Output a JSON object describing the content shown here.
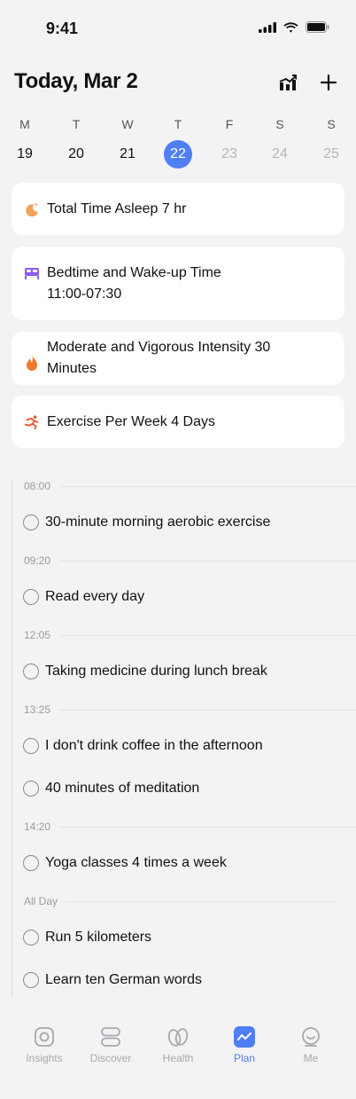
{
  "status_bar": {
    "time": "9:41"
  },
  "header": {
    "title": "Today, Mar 2"
  },
  "week": [
    {
      "dow": "M",
      "num": "19",
      "state": "past"
    },
    {
      "dow": "T",
      "num": "20",
      "state": "past"
    },
    {
      "dow": "W",
      "num": "21",
      "state": "past"
    },
    {
      "dow": "T",
      "num": "22",
      "state": "selected"
    },
    {
      "dow": "F",
      "num": "23",
      "state": "future"
    },
    {
      "dow": "S",
      "num": "24",
      "state": "future"
    },
    {
      "dow": "S",
      "num": "25",
      "state": "future"
    }
  ],
  "goals": [
    {
      "icon": "moon-icon",
      "color": "#f5a05a",
      "text": "Total Time Asleep 7 hr"
    },
    {
      "icon": "bed-icon",
      "color": "#8b5cf6",
      "text": "Bedtime and Wake-up Time 11:00-07:30"
    },
    {
      "icon": "flame-icon",
      "color": "#f07a2a",
      "text": "Moderate and Vigorous Intensity 30 Minutes"
    },
    {
      "icon": "runner-icon",
      "color": "#ee5a3a",
      "text": "Exercise Per Week 4 Days"
    }
  ],
  "timeline": {
    "times": [
      "08:00",
      "09:20",
      "12:05",
      "13:25",
      "14:20",
      "All Day"
    ],
    "tasks": [
      "30-minute morning aerobic exercise",
      "Read every day",
      "Taking medicine during lunch break",
      "I don't drink coffee in the afternoon",
      "40 minutes of meditation",
      "Yoga classes 4 times a week",
      "Run 5 kilometers",
      "Learn ten German words"
    ]
  },
  "tabs": [
    {
      "label": "Insights",
      "icon": "insights-icon"
    },
    {
      "label": "Discover",
      "icon": "discover-icon"
    },
    {
      "label": "Health",
      "icon": "health-icon"
    },
    {
      "label": "Plan",
      "icon": "plan-icon",
      "active": true
    },
    {
      "label": "Me",
      "icon": "me-icon"
    }
  ],
  "colors": {
    "accent": "#4f7ef5",
    "background": "#f3f3f5"
  }
}
